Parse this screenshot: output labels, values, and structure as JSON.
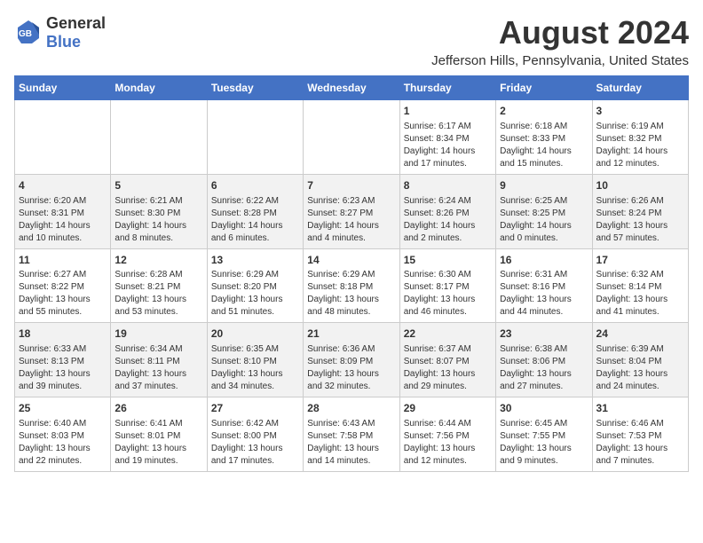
{
  "header": {
    "logo_general": "General",
    "logo_blue": "Blue",
    "title": "August 2024",
    "subtitle": "Jefferson Hills, Pennsylvania, United States"
  },
  "weekdays": [
    "Sunday",
    "Monday",
    "Tuesday",
    "Wednesday",
    "Thursday",
    "Friday",
    "Saturday"
  ],
  "weeks": [
    [
      {
        "day": "",
        "info": ""
      },
      {
        "day": "",
        "info": ""
      },
      {
        "day": "",
        "info": ""
      },
      {
        "day": "",
        "info": ""
      },
      {
        "day": "1",
        "info": "Sunrise: 6:17 AM\nSunset: 8:34 PM\nDaylight: 14 hours\nand 17 minutes."
      },
      {
        "day": "2",
        "info": "Sunrise: 6:18 AM\nSunset: 8:33 PM\nDaylight: 14 hours\nand 15 minutes."
      },
      {
        "day": "3",
        "info": "Sunrise: 6:19 AM\nSunset: 8:32 PM\nDaylight: 14 hours\nand 12 minutes."
      }
    ],
    [
      {
        "day": "4",
        "info": "Sunrise: 6:20 AM\nSunset: 8:31 PM\nDaylight: 14 hours\nand 10 minutes."
      },
      {
        "day": "5",
        "info": "Sunrise: 6:21 AM\nSunset: 8:30 PM\nDaylight: 14 hours\nand 8 minutes."
      },
      {
        "day": "6",
        "info": "Sunrise: 6:22 AM\nSunset: 8:28 PM\nDaylight: 14 hours\nand 6 minutes."
      },
      {
        "day": "7",
        "info": "Sunrise: 6:23 AM\nSunset: 8:27 PM\nDaylight: 14 hours\nand 4 minutes."
      },
      {
        "day": "8",
        "info": "Sunrise: 6:24 AM\nSunset: 8:26 PM\nDaylight: 14 hours\nand 2 minutes."
      },
      {
        "day": "9",
        "info": "Sunrise: 6:25 AM\nSunset: 8:25 PM\nDaylight: 14 hours\nand 0 minutes."
      },
      {
        "day": "10",
        "info": "Sunrise: 6:26 AM\nSunset: 8:24 PM\nDaylight: 13 hours\nand 57 minutes."
      }
    ],
    [
      {
        "day": "11",
        "info": "Sunrise: 6:27 AM\nSunset: 8:22 PM\nDaylight: 13 hours\nand 55 minutes."
      },
      {
        "day": "12",
        "info": "Sunrise: 6:28 AM\nSunset: 8:21 PM\nDaylight: 13 hours\nand 53 minutes."
      },
      {
        "day": "13",
        "info": "Sunrise: 6:29 AM\nSunset: 8:20 PM\nDaylight: 13 hours\nand 51 minutes."
      },
      {
        "day": "14",
        "info": "Sunrise: 6:29 AM\nSunset: 8:18 PM\nDaylight: 13 hours\nand 48 minutes."
      },
      {
        "day": "15",
        "info": "Sunrise: 6:30 AM\nSunset: 8:17 PM\nDaylight: 13 hours\nand 46 minutes."
      },
      {
        "day": "16",
        "info": "Sunrise: 6:31 AM\nSunset: 8:16 PM\nDaylight: 13 hours\nand 44 minutes."
      },
      {
        "day": "17",
        "info": "Sunrise: 6:32 AM\nSunset: 8:14 PM\nDaylight: 13 hours\nand 41 minutes."
      }
    ],
    [
      {
        "day": "18",
        "info": "Sunrise: 6:33 AM\nSunset: 8:13 PM\nDaylight: 13 hours\nand 39 minutes."
      },
      {
        "day": "19",
        "info": "Sunrise: 6:34 AM\nSunset: 8:11 PM\nDaylight: 13 hours\nand 37 minutes."
      },
      {
        "day": "20",
        "info": "Sunrise: 6:35 AM\nSunset: 8:10 PM\nDaylight: 13 hours\nand 34 minutes."
      },
      {
        "day": "21",
        "info": "Sunrise: 6:36 AM\nSunset: 8:09 PM\nDaylight: 13 hours\nand 32 minutes."
      },
      {
        "day": "22",
        "info": "Sunrise: 6:37 AM\nSunset: 8:07 PM\nDaylight: 13 hours\nand 29 minutes."
      },
      {
        "day": "23",
        "info": "Sunrise: 6:38 AM\nSunset: 8:06 PM\nDaylight: 13 hours\nand 27 minutes."
      },
      {
        "day": "24",
        "info": "Sunrise: 6:39 AM\nSunset: 8:04 PM\nDaylight: 13 hours\nand 24 minutes."
      }
    ],
    [
      {
        "day": "25",
        "info": "Sunrise: 6:40 AM\nSunset: 8:03 PM\nDaylight: 13 hours\nand 22 minutes."
      },
      {
        "day": "26",
        "info": "Sunrise: 6:41 AM\nSunset: 8:01 PM\nDaylight: 13 hours\nand 19 minutes."
      },
      {
        "day": "27",
        "info": "Sunrise: 6:42 AM\nSunset: 8:00 PM\nDaylight: 13 hours\nand 17 minutes."
      },
      {
        "day": "28",
        "info": "Sunrise: 6:43 AM\nSunset: 7:58 PM\nDaylight: 13 hours\nand 14 minutes."
      },
      {
        "day": "29",
        "info": "Sunrise: 6:44 AM\nSunset: 7:56 PM\nDaylight: 13 hours\nand 12 minutes."
      },
      {
        "day": "30",
        "info": "Sunrise: 6:45 AM\nSunset: 7:55 PM\nDaylight: 13 hours\nand 9 minutes."
      },
      {
        "day": "31",
        "info": "Sunrise: 6:46 AM\nSunset: 7:53 PM\nDaylight: 13 hours\nand 7 minutes."
      }
    ]
  ],
  "colors": {
    "header_bg": "#4472c4",
    "header_text": "#ffffff",
    "even_row_bg": "#f2f2f2",
    "odd_row_bg": "#ffffff"
  }
}
